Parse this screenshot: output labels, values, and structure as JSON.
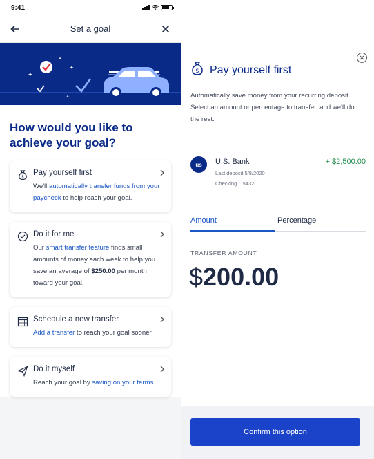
{
  "status_bar": {
    "time": "9:41"
  },
  "nav": {
    "title": "Set a goal",
    "back_icon": "arrow-left-icon",
    "close_icon": "close-icon"
  },
  "heading": "How would you like to achieve your goal?",
  "options": [
    {
      "title": "Pay yourself first",
      "icon": "money-bag-icon",
      "desc_parts": [
        "We'll ",
        "automatically transfer funds from your paycheck",
        " to help reach your goal."
      ]
    },
    {
      "title": "Do it for me",
      "icon": "check-circle-icon",
      "desc_parts": [
        "Our ",
        "smart transfer feature",
        " finds small amounts of money each week to help you save an average of ",
        "$250.00",
        " per month toward your goal."
      ]
    },
    {
      "title": "Schedule a new transfer",
      "icon": "calendar-icon",
      "desc_parts": [
        "",
        "Add a transfer",
        " to reach your goal sooner."
      ]
    },
    {
      "title": "Do it myself",
      "icon": "paper-plane-icon",
      "desc_parts": [
        "Reach your goal by ",
        "saving on your terms",
        "."
      ]
    }
  ],
  "sheet": {
    "title": "Pay yourself first",
    "description": "Automatically save money from your recurring deposit. Select an amount or percentage to transfer, and we'll do the rest.",
    "bank": {
      "logo_text": "us",
      "name": "U.S. Bank",
      "amount": "+ $2,500.00",
      "last_deposit": "Last deposit 5/8/2020",
      "account": "Checking ...5432"
    },
    "tabs": [
      "Amount",
      "Percentage"
    ],
    "active_tab": "Amount",
    "transfer_label": "TRANSFER AMOUNT",
    "transfer_currency": "$",
    "transfer_value": "200.00",
    "confirm_label": "Confirm this option"
  },
  "colors": {
    "brand_navy": "#0a2a88",
    "link_blue": "#1a56c4",
    "button_blue": "#1a43c9",
    "positive_green": "#1f8a4c"
  }
}
